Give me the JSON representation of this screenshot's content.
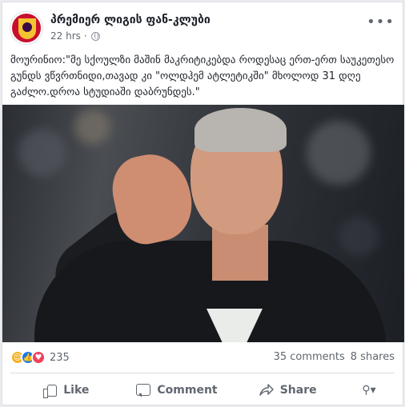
{
  "post": {
    "page_name": "პრემიერ ლიგის ფან-კლუბი",
    "time": "22 hrs ·",
    "text": "მოურინიო:\"მე სქოულზი მაშინ მაკრიტიკებდა როდესაც ერთ-ერთ საუკეთესო გუნდს ვწვრთნიდი,თავად კი \"ოლდჰემ ატლეტიკში\" მხოლოდ 31 დღე გაძლო.დროა სტუდიაში დაბრუნდეს.\""
  },
  "stats": {
    "reaction_count": "235",
    "comments": "35 comments",
    "shares": "8 shares"
  },
  "actions": {
    "like": "Like",
    "comment": "Comment",
    "share": "Share"
  },
  "icons": {
    "avatar": "premier-league-crest-icon",
    "privacy": "globe-icon",
    "menu": "more-dots-icon",
    "reactions": [
      "haha-icon",
      "like-icon",
      "love-icon"
    ]
  },
  "colors": {
    "facebook_blue": "#1877f2",
    "love_red": "#f33e58",
    "haha_yellow": "#f7b125",
    "avatar_red": "#c8102e"
  }
}
